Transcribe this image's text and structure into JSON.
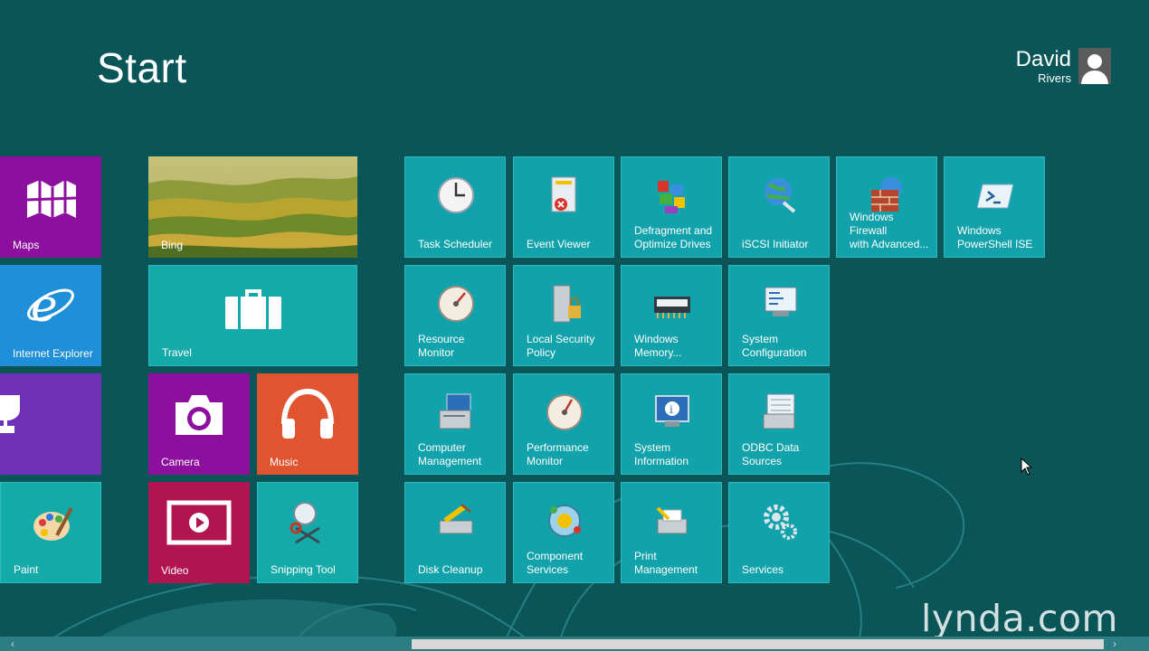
{
  "start": {
    "title": "Start"
  },
  "user": {
    "first_name": "David",
    "last_name": "Rivers"
  },
  "tiles": {
    "maps": "Maps",
    "bing": "Bing",
    "internet_explorer": "Internet Explorer",
    "travel": "Travel",
    "camera": "Camera",
    "music": "Music",
    "paint": "Paint",
    "video": "Video",
    "snipping_tool": "Snipping Tool"
  },
  "admin_tools": {
    "task_scheduler": "Task Scheduler",
    "event_viewer": "Event Viewer",
    "defragment": "Defragment and\nOptimize Drives",
    "iscsi": "iSCSI Initiator",
    "firewall": "Windows Firewall\nwith Advanced...",
    "powershell_ise": "Windows\nPowerShell ISE",
    "resource_monitor": "Resource\nMonitor",
    "local_security_policy": "Local Security\nPolicy",
    "memory_diag": "Windows\nMemory...",
    "system_config": "System\nConfiguration",
    "computer_management": "Computer\nManagement",
    "performance_monitor": "Performance\nMonitor",
    "system_information": "System\nInformation",
    "odbc": "ODBC Data\nSources",
    "disk_cleanup": "Disk Cleanup",
    "component_services": "Component\nServices",
    "print_management": "Print\nManagement",
    "services": "Services"
  },
  "watermark": {
    "text": "lynda.com"
  },
  "colors": {
    "background": "#0a5558",
    "admin_tile": "#12a2ab",
    "purple": "#8c0f9e",
    "blue": "#1e8fd8",
    "violet": "#6e31b8",
    "teal": "#14aaa9",
    "orange": "#e0552f",
    "crimson": "#b0154f"
  }
}
